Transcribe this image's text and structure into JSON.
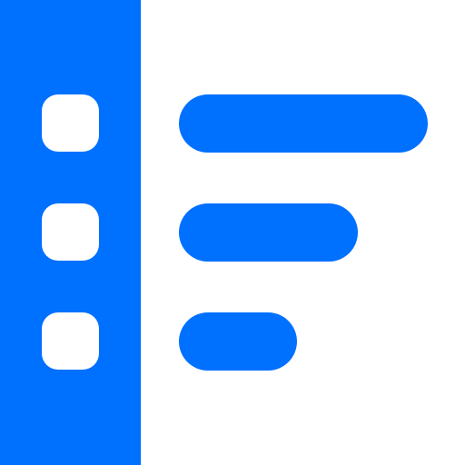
{
  "icon": {
    "name": "list-layout-icon",
    "colors": {
      "accent": "#0070ff",
      "background": "#ffffff"
    },
    "rows": [
      {
        "bullet_icon": "rounded-square-bullet",
        "line_length_fraction": 1.0
      },
      {
        "bullet_icon": "rounded-square-bullet",
        "line_length_fraction": 0.72
      },
      {
        "bullet_icon": "rounded-square-bullet",
        "line_length_fraction": 0.47
      }
    ]
  }
}
